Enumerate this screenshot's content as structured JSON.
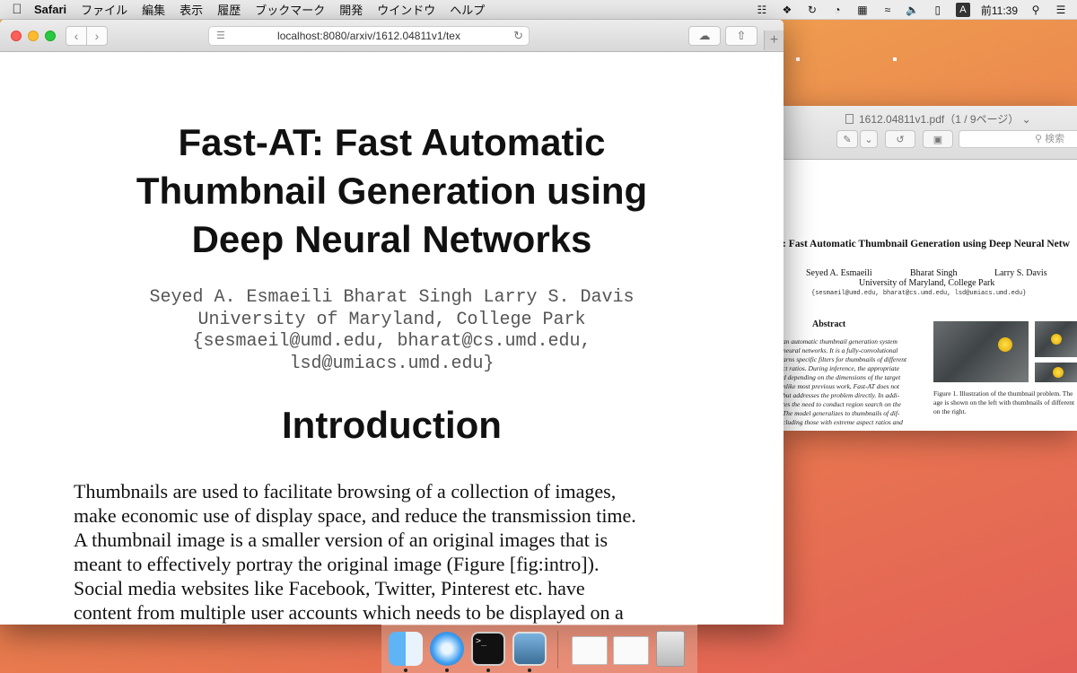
{
  "menubar": {
    "app_name": "Safari",
    "items": [
      "ファイル",
      "編集",
      "表示",
      "履歴",
      "ブックマーク",
      "開発",
      "ウインドウ",
      "ヘルプ"
    ],
    "input_badge": "A",
    "clock": "前11:39"
  },
  "safari": {
    "url": "localhost:8080/arxiv/1612.04811v1/tex",
    "document": {
      "title_lines": [
        "Fast-AT: Fast Automatic",
        "Thumbnail Generation using",
        "Deep Neural Networks"
      ],
      "author_lines": [
        "Seyed A. Esmaeili Bharat Singh Larry S. Davis",
        "University of Maryland, College Park",
        "{sesmaeil@umd.edu, bharat@cs.umd.edu,",
        "lsd@umiacs.umd.edu}"
      ],
      "section_heading": "Introduction",
      "body_lines": [
        "Thumbnails are used to facilitate browsing of a collection of images,",
        "make economic use of display space, and reduce the transmission time.",
        "A thumbnail image is a smaller version of an original images that is",
        "meant to effectively portray the original image (Figure [fig:intro]).",
        "Social media websites like Facebook, Twitter, Pinterest etc. have",
        "content from multiple user accounts which needs to be displayed on a"
      ]
    }
  },
  "preview": {
    "window_title": "1612.04811v1.pdf（1 / 9ページ）",
    "search_placeholder": "検索",
    "pdf": {
      "title": ": Fast Automatic Thumbnail Generation using Deep Neural Netw",
      "authors": [
        "Seyed A. Esmaeili",
        "Bharat Singh",
        "Larry S. Davis"
      ],
      "affiliation": "University of Maryland, College Park",
      "emails": "{sesmaeil@umd.edu, bharat@cs.umd.edu, lsd@umiacs.umd.edu}",
      "abstract_heading": "Abstract",
      "abstract_lines": [
        "an automatic thumbnail generation system",
        "neural networks. It is a fully-convolutional",
        "arns specific filters for thumbnails of different",
        "ct ratios. During inference, the appropriate",
        "d depending on the dimensions of the target",
        "nlike most previous work, Fast-AT does not",
        "but addresses the problem directly. In addi-",
        "tes the need to conduct region search on the",
        "The model generalizes to thumbnails of dif-",
        "cluding those with extreme aspect ratios and"
      ],
      "caption_lines": [
        "Figure 1. Illustration of the thumbnail problem. The",
        "age is shown on the left with thumbnails of different",
        "on the right."
      ]
    }
  },
  "dock": {
    "apps": [
      "finder-icon",
      "safari-icon",
      "terminal-icon",
      "preview-icon",
      "document-thumb-icon",
      "document-thumb-icon",
      "trash-icon"
    ]
  }
}
